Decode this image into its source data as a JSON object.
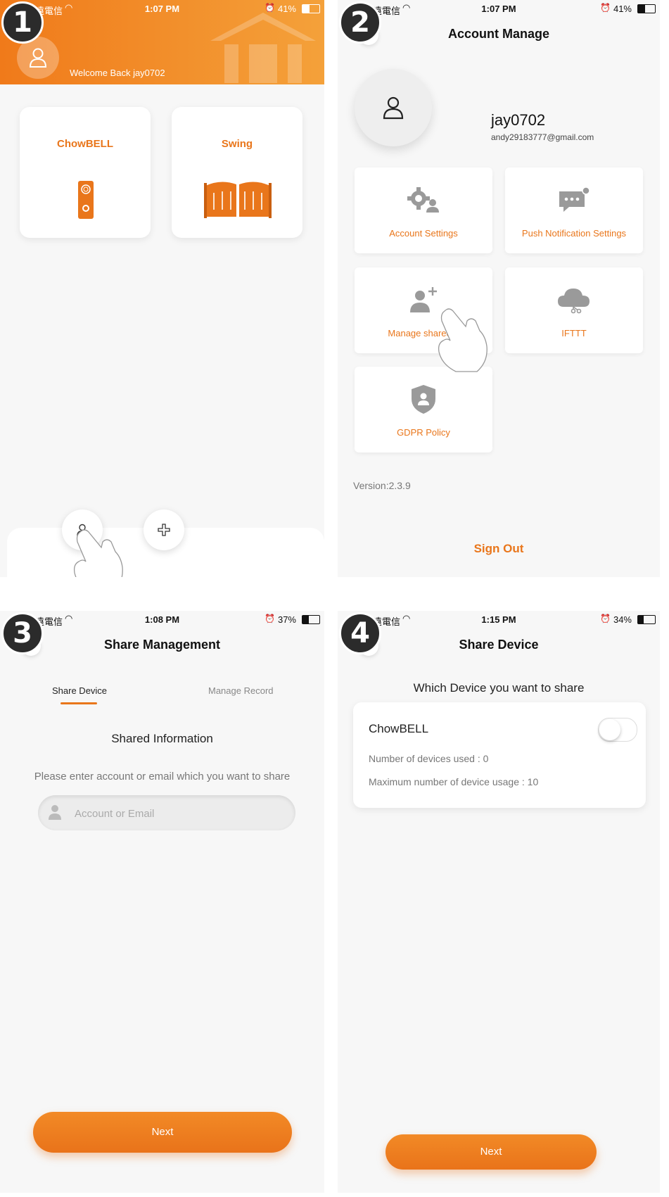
{
  "steps": [
    "1",
    "2",
    "3",
    "4"
  ],
  "accent_color": "#e9761b",
  "screen1": {
    "status": {
      "carrier": "遠電信",
      "time": "1:07 PM",
      "battery": "41%"
    },
    "welcome_text": "Welcome Back jay0702",
    "devices": [
      {
        "name": "ChowBELL",
        "icon": "doorbell-icon"
      },
      {
        "name": "Swing",
        "icon": "gate-icon"
      }
    ],
    "bottom_buttons": [
      {
        "icon": "user-icon"
      },
      {
        "icon": "plus-icon"
      }
    ]
  },
  "screen2": {
    "status": {
      "carrier": "遠電信",
      "time": "1:07 PM",
      "battery": "41%"
    },
    "title": "Account Manage",
    "username": "jay0702",
    "email": "andy29183777@gmail.com",
    "tiles": [
      {
        "label": "Account Settings",
        "icon": "gear-user-icon"
      },
      {
        "label": "Push Notification Settings",
        "icon": "chat-bubble-icon"
      },
      {
        "label": "Manage shared d",
        "icon": "user-add-icon"
      },
      {
        "label": "IFTTT",
        "icon": "cloud-icon"
      },
      {
        "label": "GDPR Policy",
        "icon": "shield-user-icon"
      }
    ],
    "version": "Version:2.3.9",
    "sign_out": "Sign Out"
  },
  "screen3": {
    "status": {
      "carrier": "遠電信",
      "time": "1:08 PM",
      "battery": "37%"
    },
    "title": "Share Management",
    "tabs": [
      "Share Device",
      "Manage Record"
    ],
    "shared_info": "Shared Information",
    "prompt": "Please enter account or email which you want to share",
    "input_placeholder": "Account or Email",
    "next": "Next"
  },
  "screen4": {
    "status": {
      "carrier": "遠電信",
      "time": "1:15 PM",
      "battery": "34%"
    },
    "title": "Share Device",
    "question": "Which Device you want to share",
    "device": {
      "name": "ChowBELL",
      "used": "Number of devices used :  0",
      "max": "Maximum number of device usage : 10",
      "toggle_on": false
    },
    "next": "Next"
  }
}
